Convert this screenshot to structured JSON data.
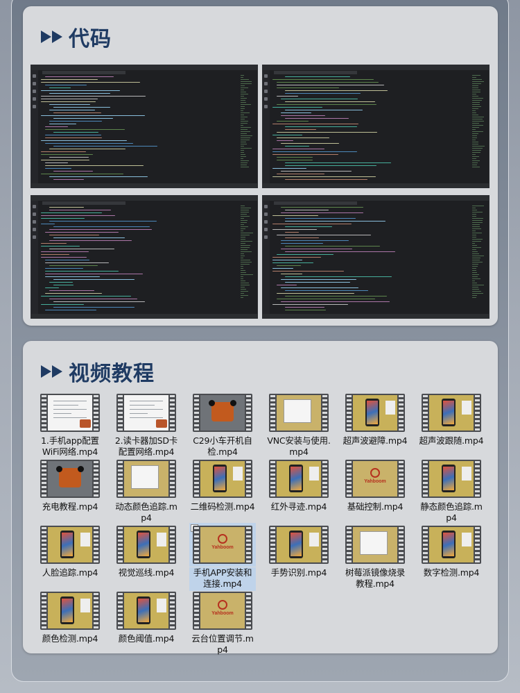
{
  "sections": {
    "code": {
      "title": "代码"
    },
    "video": {
      "title": "视频教程"
    }
  },
  "videos": [
    {
      "name": "1.手机app配置WiFi网络.mp4",
      "thumb": "doc-car"
    },
    {
      "name": "2.读卡器加SD卡配置网络.mp4",
      "thumb": "doc-car"
    },
    {
      "name": "C29小车开机自检.mp4",
      "thumb": "car"
    },
    {
      "name": "VNC安装与使用.mp4",
      "thumb": "desk"
    },
    {
      "name": "超声波避障.mp4",
      "thumb": "phone"
    },
    {
      "name": "超声波跟随.mp4",
      "thumb": "phone"
    },
    {
      "name": "充电教程.mp4",
      "thumb": "car"
    },
    {
      "name": "动态颜色追踪.mp4",
      "thumb": "desk"
    },
    {
      "name": "二维码检测.mp4",
      "thumb": "phone"
    },
    {
      "name": "红外寻迹.mp4",
      "thumb": "phone"
    },
    {
      "name": "基础控制.mp4",
      "thumb": "logo"
    },
    {
      "name": "静态颜色追踪.mp4",
      "thumb": "phone"
    },
    {
      "name": "人脸追踪.mp4",
      "thumb": "phone"
    },
    {
      "name": "视觉巡线.mp4",
      "thumb": "phone"
    },
    {
      "name": "手机APP安装和连接.mp4",
      "thumb": "logo",
      "selected": true
    },
    {
      "name": "手势识别.mp4",
      "thumb": "phone"
    },
    {
      "name": "树莓派镜像烧录教程.mp4",
      "thumb": "desk"
    },
    {
      "name": "数字检测.mp4",
      "thumb": "phone"
    },
    {
      "name": "颜色检测.mp4",
      "thumb": "phone"
    },
    {
      "name": "颜色阈值.mp4",
      "thumb": "phone"
    },
    {
      "name": "云台位置调节.mp4",
      "thumb": "logo"
    }
  ],
  "logo_text": "Yahboom"
}
